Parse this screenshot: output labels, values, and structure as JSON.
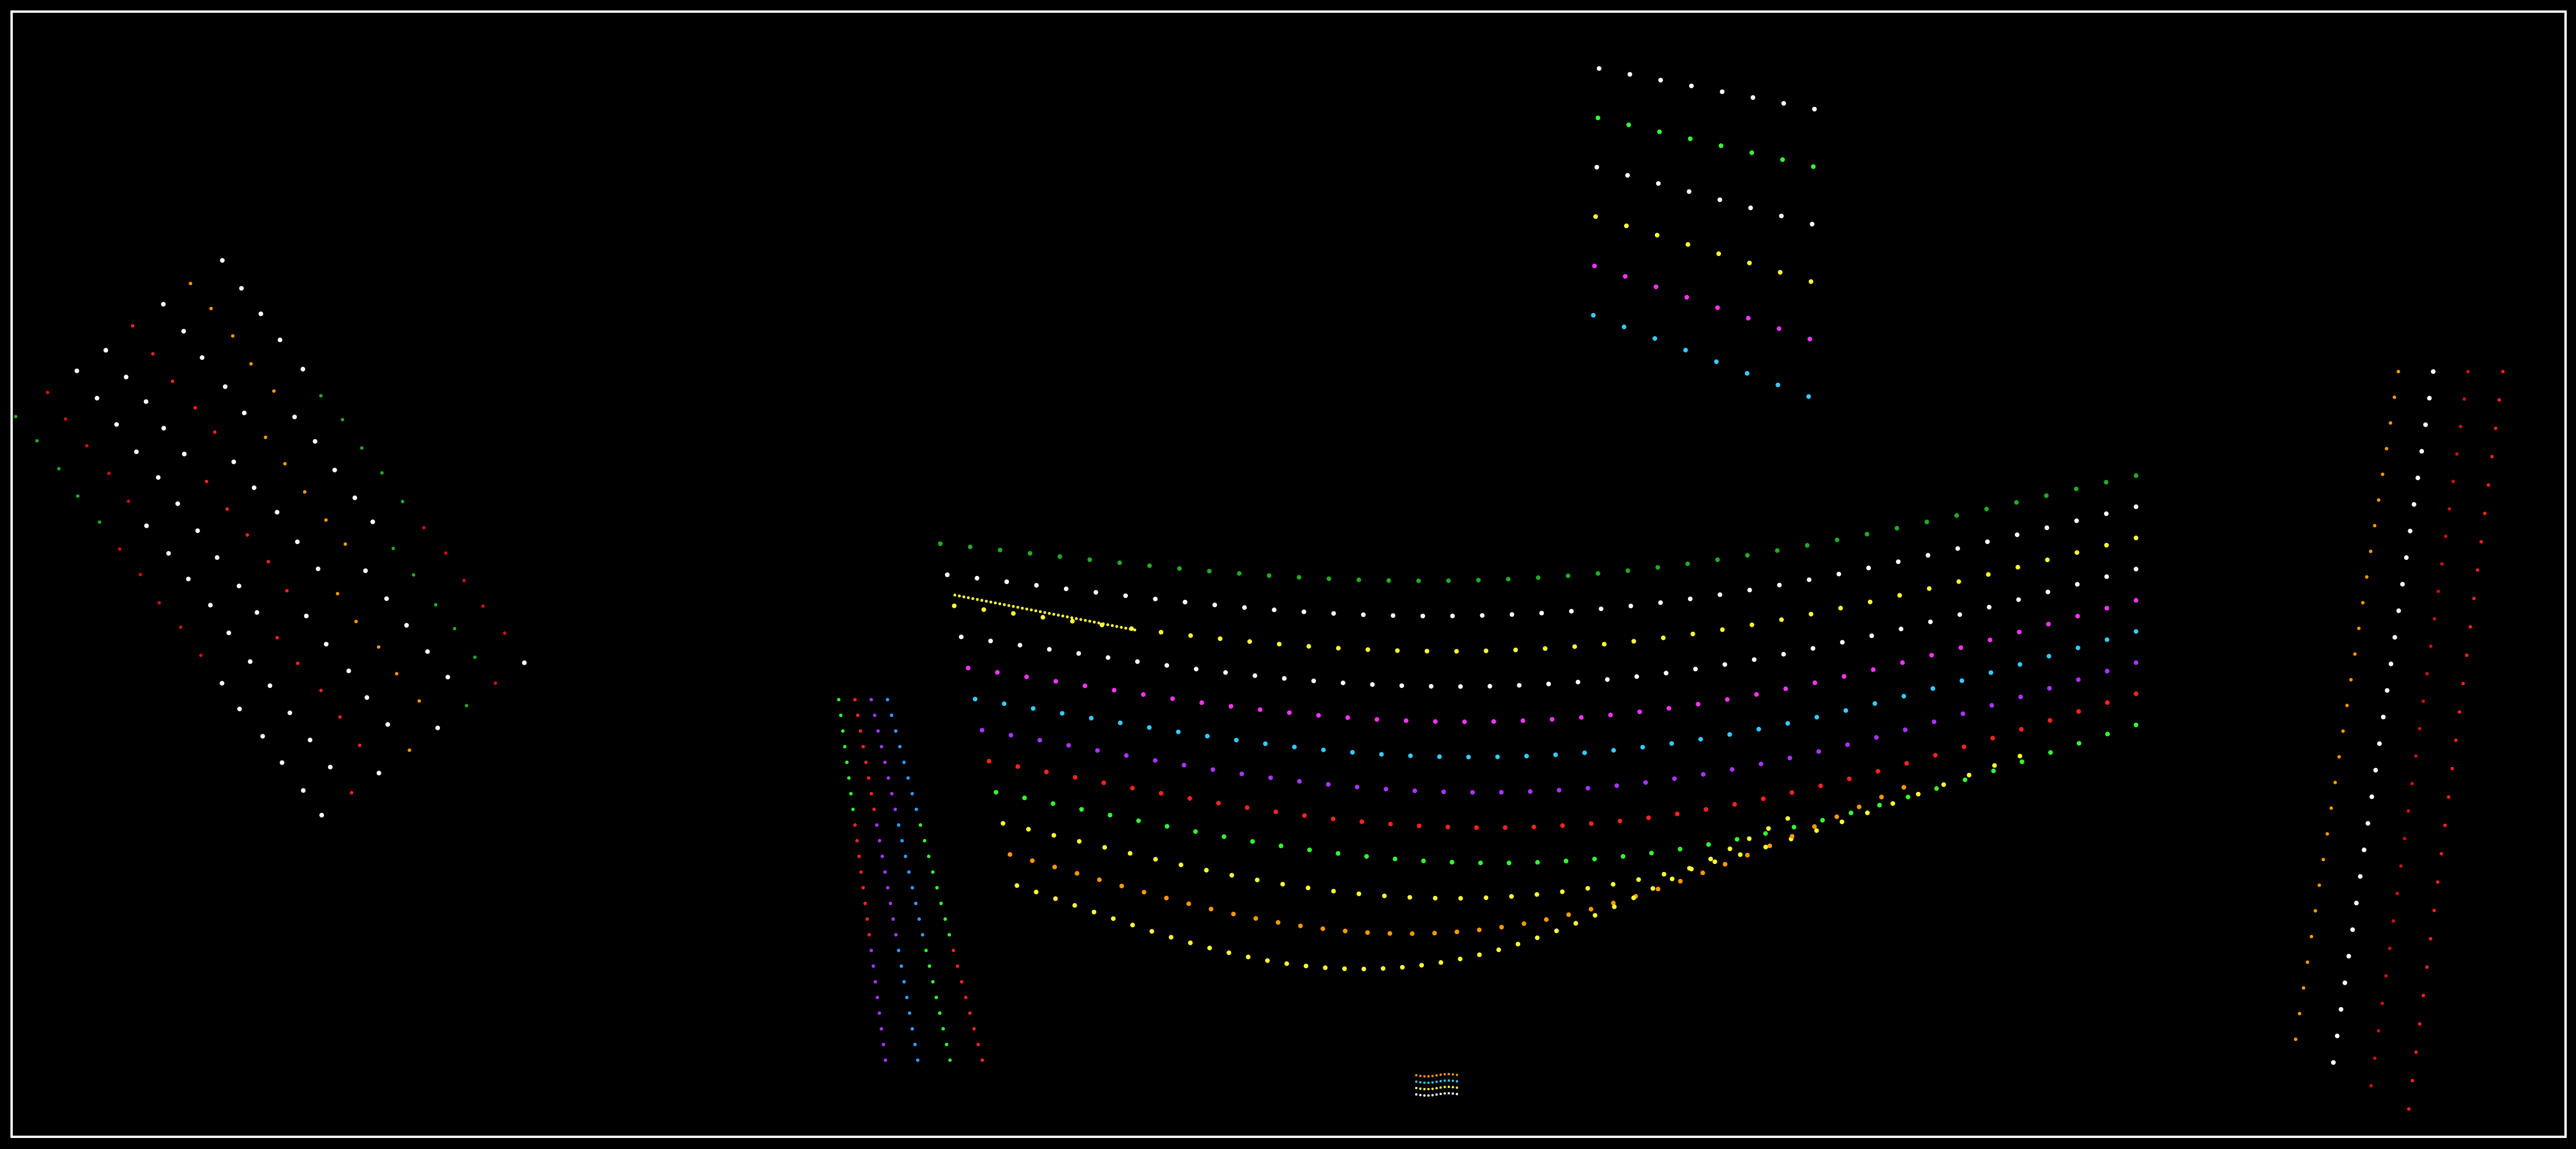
{
  "background": "#000000",
  "frame_color": "#ffffff",
  "palette": {
    "white": "#ffffff",
    "yellow": "#ffff33",
    "magenta": "#ff33ff",
    "cyan": "#33ccff",
    "purple": "#aa33ff",
    "red": "#ff2222",
    "green": "#33ff33",
    "orange": "#ff9900",
    "dark_red": "#cc1111",
    "dark_green": "#22aa22",
    "blue": "#3399ff"
  }
}
